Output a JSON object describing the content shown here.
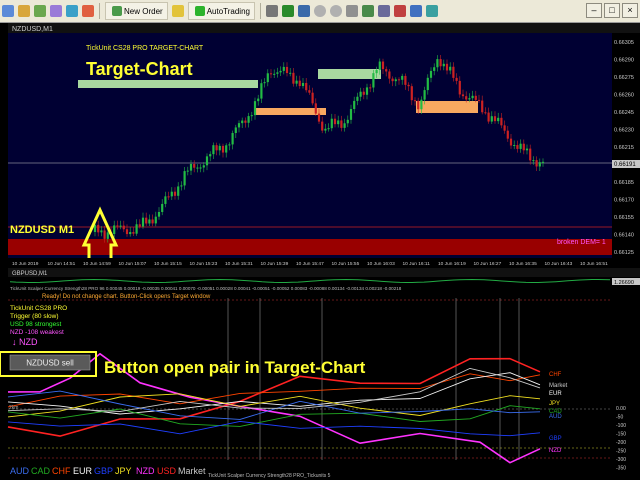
{
  "toolbar": {
    "new_order_label": "New Order",
    "autotrading_label": "AutoTrading"
  },
  "top_chart": {
    "title": "NZDUSD,M1",
    "indicator_label": "TickUnit CS28 PRO TARGET-CHART",
    "annotation": "Target-Chart",
    "pair_label": "NZDUSD M1",
    "dem_label": "broken DEM= 1",
    "current_price": "0.66191",
    "price_scale": [
      "0.66305",
      "0.66290",
      "0.66275",
      "0.66260",
      "0.66245",
      "0.66230",
      "0.66215",
      "0.66200",
      "0.66185",
      "0.66170",
      "0.66155",
      "0.66140",
      "0.66125"
    ],
    "time_labels": [
      "10 Jun 2019",
      "10 Jun 14:51",
      "10 Jun 14:59",
      "10 Jun 15:07",
      "10 Jun 15:15",
      "10 Jun 15:23",
      "10 Jun 15:31",
      "10 Jun 15:39",
      "10 Jun 15:47",
      "10 Jun 15:55",
      "10 Jun 16:03",
      "10 Jun 16:11",
      "10 Jun 16:19",
      "10 Jun 16:27",
      "10 Jun 16:35",
      "10 Jun 16:43",
      "10 Jun 16:51"
    ]
  },
  "bottom_chart": {
    "title": "GBPUSD,M1",
    "top_value": "1.26690",
    "values_strip": "TickUnit Scalper Currency Strength28 PRO 96 0.00045 0.00019 -0.00035 0.00041 0.00070 -0.00051 0.00028 0.00041 -0.00051 -0.00052 0.00083 -0.00088 0.00134 -0.00134 0.00218 -0.00218",
    "status_text": "Ready! Do not change chart. Button-Click opens Target window",
    "info_lines": [
      "TickUnit CS28 PRO",
      "Trigger (80 slow)",
      "USD 98 strongest",
      "NZD -108 weakest"
    ],
    "arrow_label": "↓ NZD",
    "sell_button": "NZDUSD sell",
    "annotation": "Button open pair in Target-Chart",
    "right_labels": [
      "CHF",
      "Market",
      "EUR",
      "JPY",
      "CAD",
      "AUD",
      "GBP",
      "NZD"
    ],
    "scale_labels": [
      "0.00",
      "-50",
      "-100",
      "-150",
      "-200",
      "-250",
      "-300",
      "-350"
    ],
    "left_marker": "2km",
    "legend": [
      "AUD",
      "CAD",
      "CHF",
      "EUR",
      "GBP",
      "JPY",
      "NZD",
      "USD",
      "Market"
    ],
    "footer_text": "TickUnit Scalper Currency Strength28 PRO_Tickunits 5"
  },
  "colors": {
    "AUD": "#3a6df0",
    "CAD": "#22aa22",
    "CHF": "#ff4400",
    "EUR": "#f5f5f5",
    "GBP": "#1f3fff",
    "JPY": "#f0e020",
    "NZD": "#ff33ff",
    "USD": "#ff2222",
    "Market": "#c8c8c8",
    "bull_candle": "#22bb44",
    "bear_candle": "#cc2222",
    "annotation": "#ffff33"
  }
}
